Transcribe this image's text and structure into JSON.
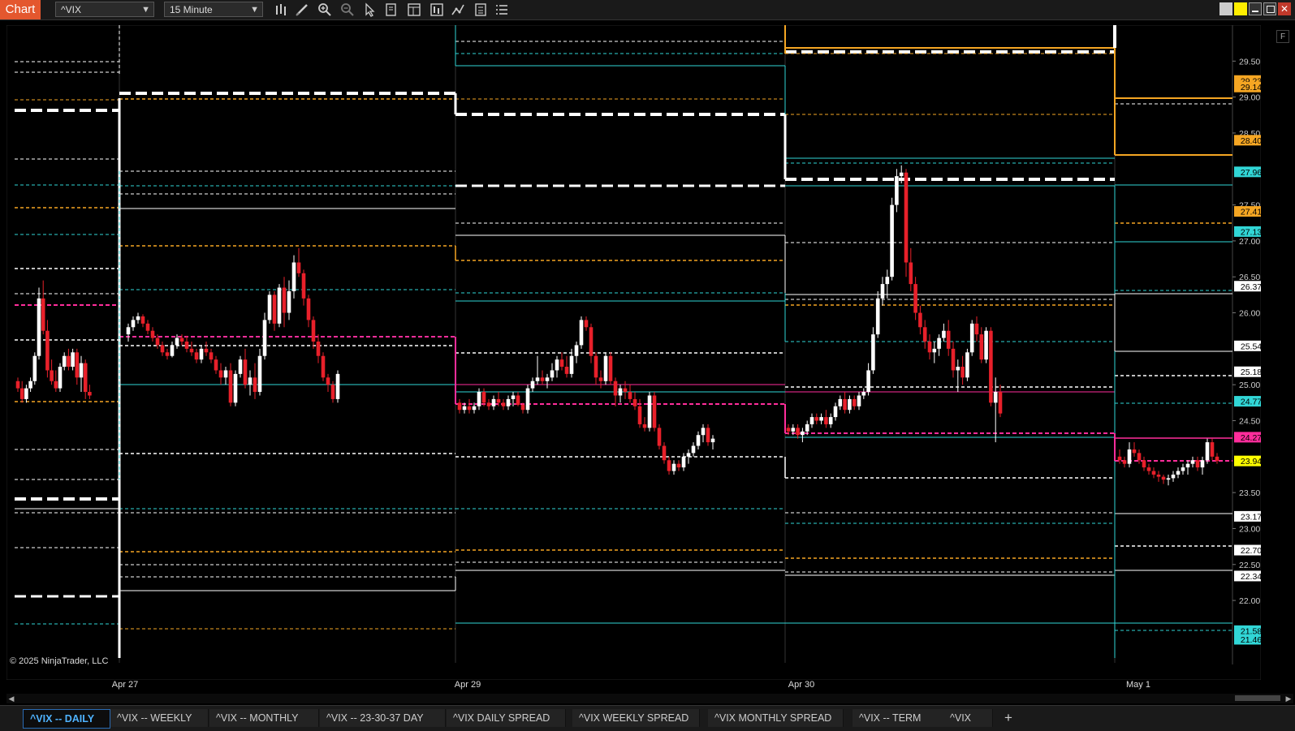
{
  "toolbar": {
    "chart_tab": "Chart",
    "instrument": "^VIX",
    "interval": "15 Minute"
  },
  "copyright": "© 2025 NinjaTrader, LLC",
  "x_axis": [
    "Apr 27",
    "Apr 29",
    "Apr 30",
    "May 1"
  ],
  "tabs": [
    "^VIX -- DAILY",
    "^VIX -- WEEKLY",
    "^VIX -- MONTHLY",
    "^VIX -- 23-30-37 DAY",
    "^VIX DAILY SPREAD",
    "^VIX WEEKLY SPREAD",
    "^VIX MONTHLY SPREAD",
    "^VIX -- TERM",
    "^VIX"
  ],
  "f_button": "F",
  "colors": {
    "background": "#000000",
    "up_candle": "#ffffff",
    "down_candle": "#e8202a",
    "cyan": "#31d6d6",
    "orange": "#f5a623",
    "magenta": "#ff2d9b",
    "yellow": "#ffff00",
    "white": "#ffffff"
  },
  "chart_data": {
    "type": "candlestick",
    "y_axis_ticks": [
      29.5,
      29.0,
      28.5,
      27.5,
      27.0,
      26.5,
      26.0,
      25.0,
      24.5,
      23.5,
      23.0,
      22.5,
      22.0
    ],
    "y_range": [
      21.2,
      30.0
    ],
    "price_markers": [
      {
        "value": "29.23",
        "color": "#f5a623",
        "text_color": "#000"
      },
      {
        "value": "29.14",
        "color": "#f5a623",
        "text_color": "#000"
      },
      {
        "value": "28.40",
        "color": "#f5a623",
        "text_color": "#000"
      },
      {
        "value": "27.96",
        "color": "#31d6d6",
        "text_color": "#000"
      },
      {
        "value": "27.41",
        "color": "#f5a623",
        "text_color": "#000"
      },
      {
        "value": "27.13",
        "color": "#31d6d6",
        "text_color": "#000"
      },
      {
        "value": "26.37",
        "color": "#ffffff",
        "text_color": "#000"
      },
      {
        "value": "25.54",
        "color": "#ffffff",
        "text_color": "#000"
      },
      {
        "value": "25.18",
        "color": "#ffffff",
        "text_color": "#000"
      },
      {
        "value": "24.77",
        "color": "#31d6d6",
        "text_color": "#000"
      },
      {
        "value": "24.27",
        "color": "#ff2d9b",
        "text_color": "#000"
      },
      {
        "value": "23.94",
        "color": "#ffff00",
        "text_color": "#000"
      },
      {
        "value": "23.17",
        "color": "#ffffff",
        "text_color": "#000"
      },
      {
        "value": "22.70",
        "color": "#ffffff",
        "text_color": "#000"
      },
      {
        "value": "22.34",
        "color": "#ffffff",
        "text_color": "#000"
      },
      {
        "value": "21.58",
        "color": "#31d6d6",
        "text_color": "#000"
      },
      {
        "value": "21.46",
        "color": "#31d6d6",
        "text_color": "#000"
      }
    ]
  }
}
